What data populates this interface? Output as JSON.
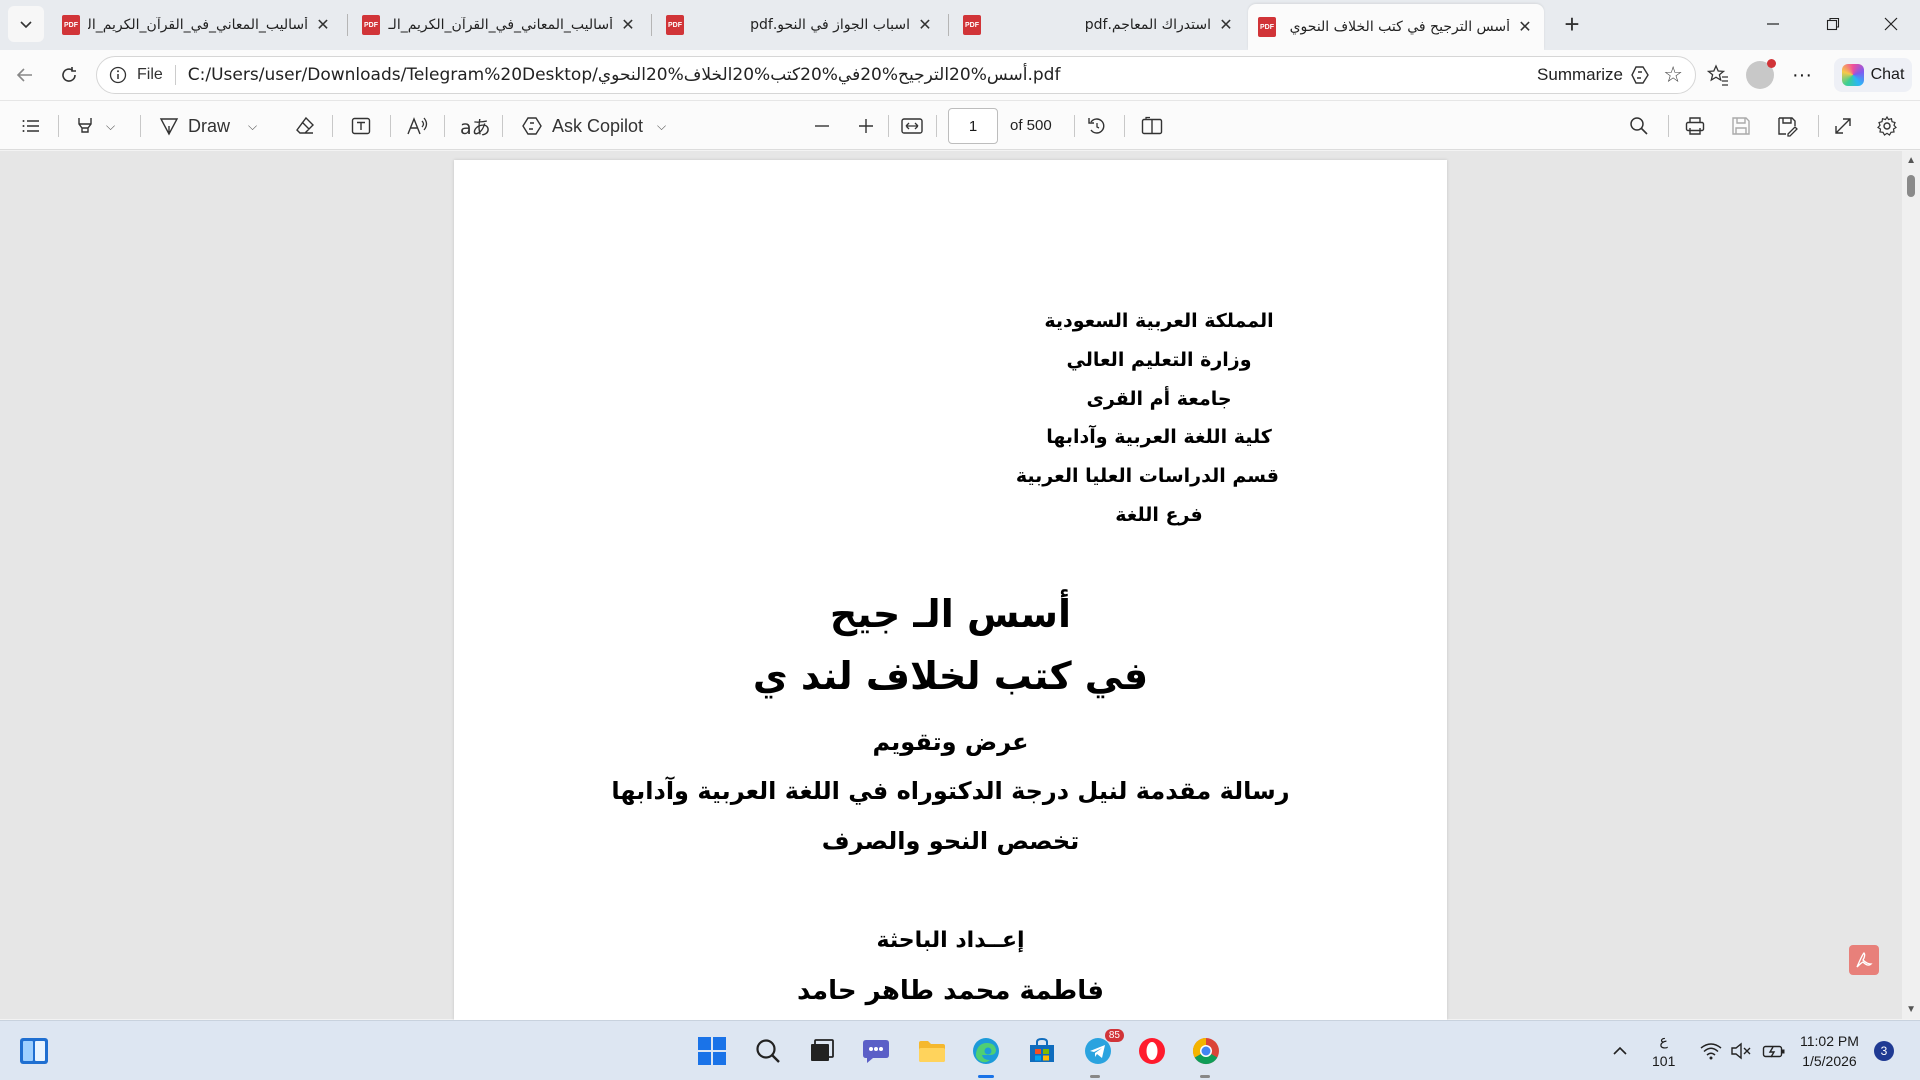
{
  "tabs": [
    {
      "title": "أساليب_المعاني_في_القرآن_الكريم_الـ",
      "active": false
    },
    {
      "title": "أساليب_المعاني_في_القرآن_الكريم_الـ",
      "active": false
    },
    {
      "title": "اسباب الجواز في النحو.pdf",
      "active": false
    },
    {
      "title": "استدراك المعاجم.pdf",
      "active": false
    },
    {
      "title": "أسس الترجيح في كتب الخلاف النحوي",
      "active": true
    }
  ],
  "address": {
    "scheme": "File",
    "url": "C:/Users/user/Downloads/Telegram%20Desktop/أسس%20الترجيح%20في%20كتب%20الخلاف%20النحوي.pdf",
    "summarize_label": "Summarize"
  },
  "chat_label": "Chat",
  "toolbar": {
    "draw_label": "Draw",
    "copilot_label": "Ask Copilot",
    "page_current": "1",
    "page_of": "of 500"
  },
  "document": {
    "header_lines": [
      "المملكة العربية السعودية",
      "وزارة التعليم العالي",
      "جامعة أم القرى",
      "كلية اللغة العربية وآدابها",
      "قسم الدراسات العليا العربية",
      "فرع اللغة"
    ],
    "title_line1": "أسس الـ جيح",
    "title_line2": "في كتب لخلاف لند ي",
    "subtitle": "عرض وتقويم",
    "thesis_line": "رسالة مقدمة لنيل درجة الدكتوراه في اللغة العربية وآدابها",
    "specialty": "تخصص النحو والصرف",
    "prepared_by": "إعــداد الباحثة",
    "author": "فاطمة محمد طاهر حامد"
  },
  "taskbar": {
    "telegram_badge": "85",
    "lang_top": "ع",
    "lang_bottom": "101",
    "time": "11:02 PM",
    "date": "1/5/2026",
    "notifications": "3"
  },
  "colors": {
    "accent_pdf": "#d13438",
    "tabstrip": "#e8ebef",
    "taskbar": "#dde6f2"
  }
}
